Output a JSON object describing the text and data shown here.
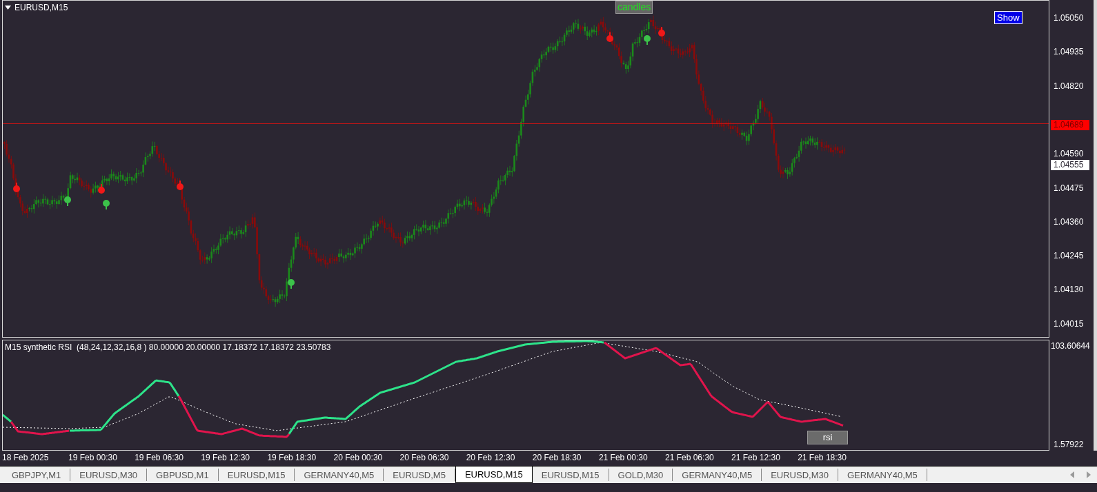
{
  "chart": {
    "symbol": "EURUSD,M15",
    "candles_label": "candles",
    "show_button": "Show",
    "price_axis": [
      "1.05050",
      "1.04935",
      "1.04820",
      "1.04590",
      "1.04475",
      "1.04360",
      "1.04245",
      "1.04130",
      "1.04015"
    ],
    "current_price_label": "1.04689",
    "bid_label": "1.04555"
  },
  "indicator": {
    "title": "M15 synthetic RSI  (48,24,12,32,16,8 ) 80.00000 20.00000 17.18372 17.18372 23.50783",
    "axis_max": "103.60644",
    "axis_min": "1.57922",
    "button": "rsi"
  },
  "time_axis": [
    "18 Feb 2025",
    "19 Feb 00:30",
    "19 Feb 06:30",
    "19 Feb 12:30",
    "19 Feb 18:30",
    "20 Feb 00:30",
    "20 Feb 06:30",
    "20 Feb 12:30",
    "20 Feb 18:30",
    "21 Feb 00:30",
    "21 Feb 06:30",
    "21 Feb 12:30",
    "21 Feb 18:30"
  ],
  "tabs": [
    {
      "label": "GBPJPY,M1",
      "selected": false
    },
    {
      "label": "EURUSD,M30",
      "selected": false
    },
    {
      "label": "GBPUSD,M1",
      "selected": false
    },
    {
      "label": "EURUSD,M15",
      "selected": false
    },
    {
      "label": "GERMANY40,M5",
      "selected": false
    },
    {
      "label": "EURUSD,M5",
      "selected": false
    },
    {
      "label": "EURUSD,M15",
      "selected": true
    },
    {
      "label": "EURUSD,M15",
      "selected": false
    },
    {
      "label": "GOLD,M30",
      "selected": false
    },
    {
      "label": "GERMANY40,M5",
      "selected": false
    },
    {
      "label": "EURUSD,M30",
      "selected": false
    },
    {
      "label": "GERMANY40,M5",
      "selected": false
    }
  ]
}
